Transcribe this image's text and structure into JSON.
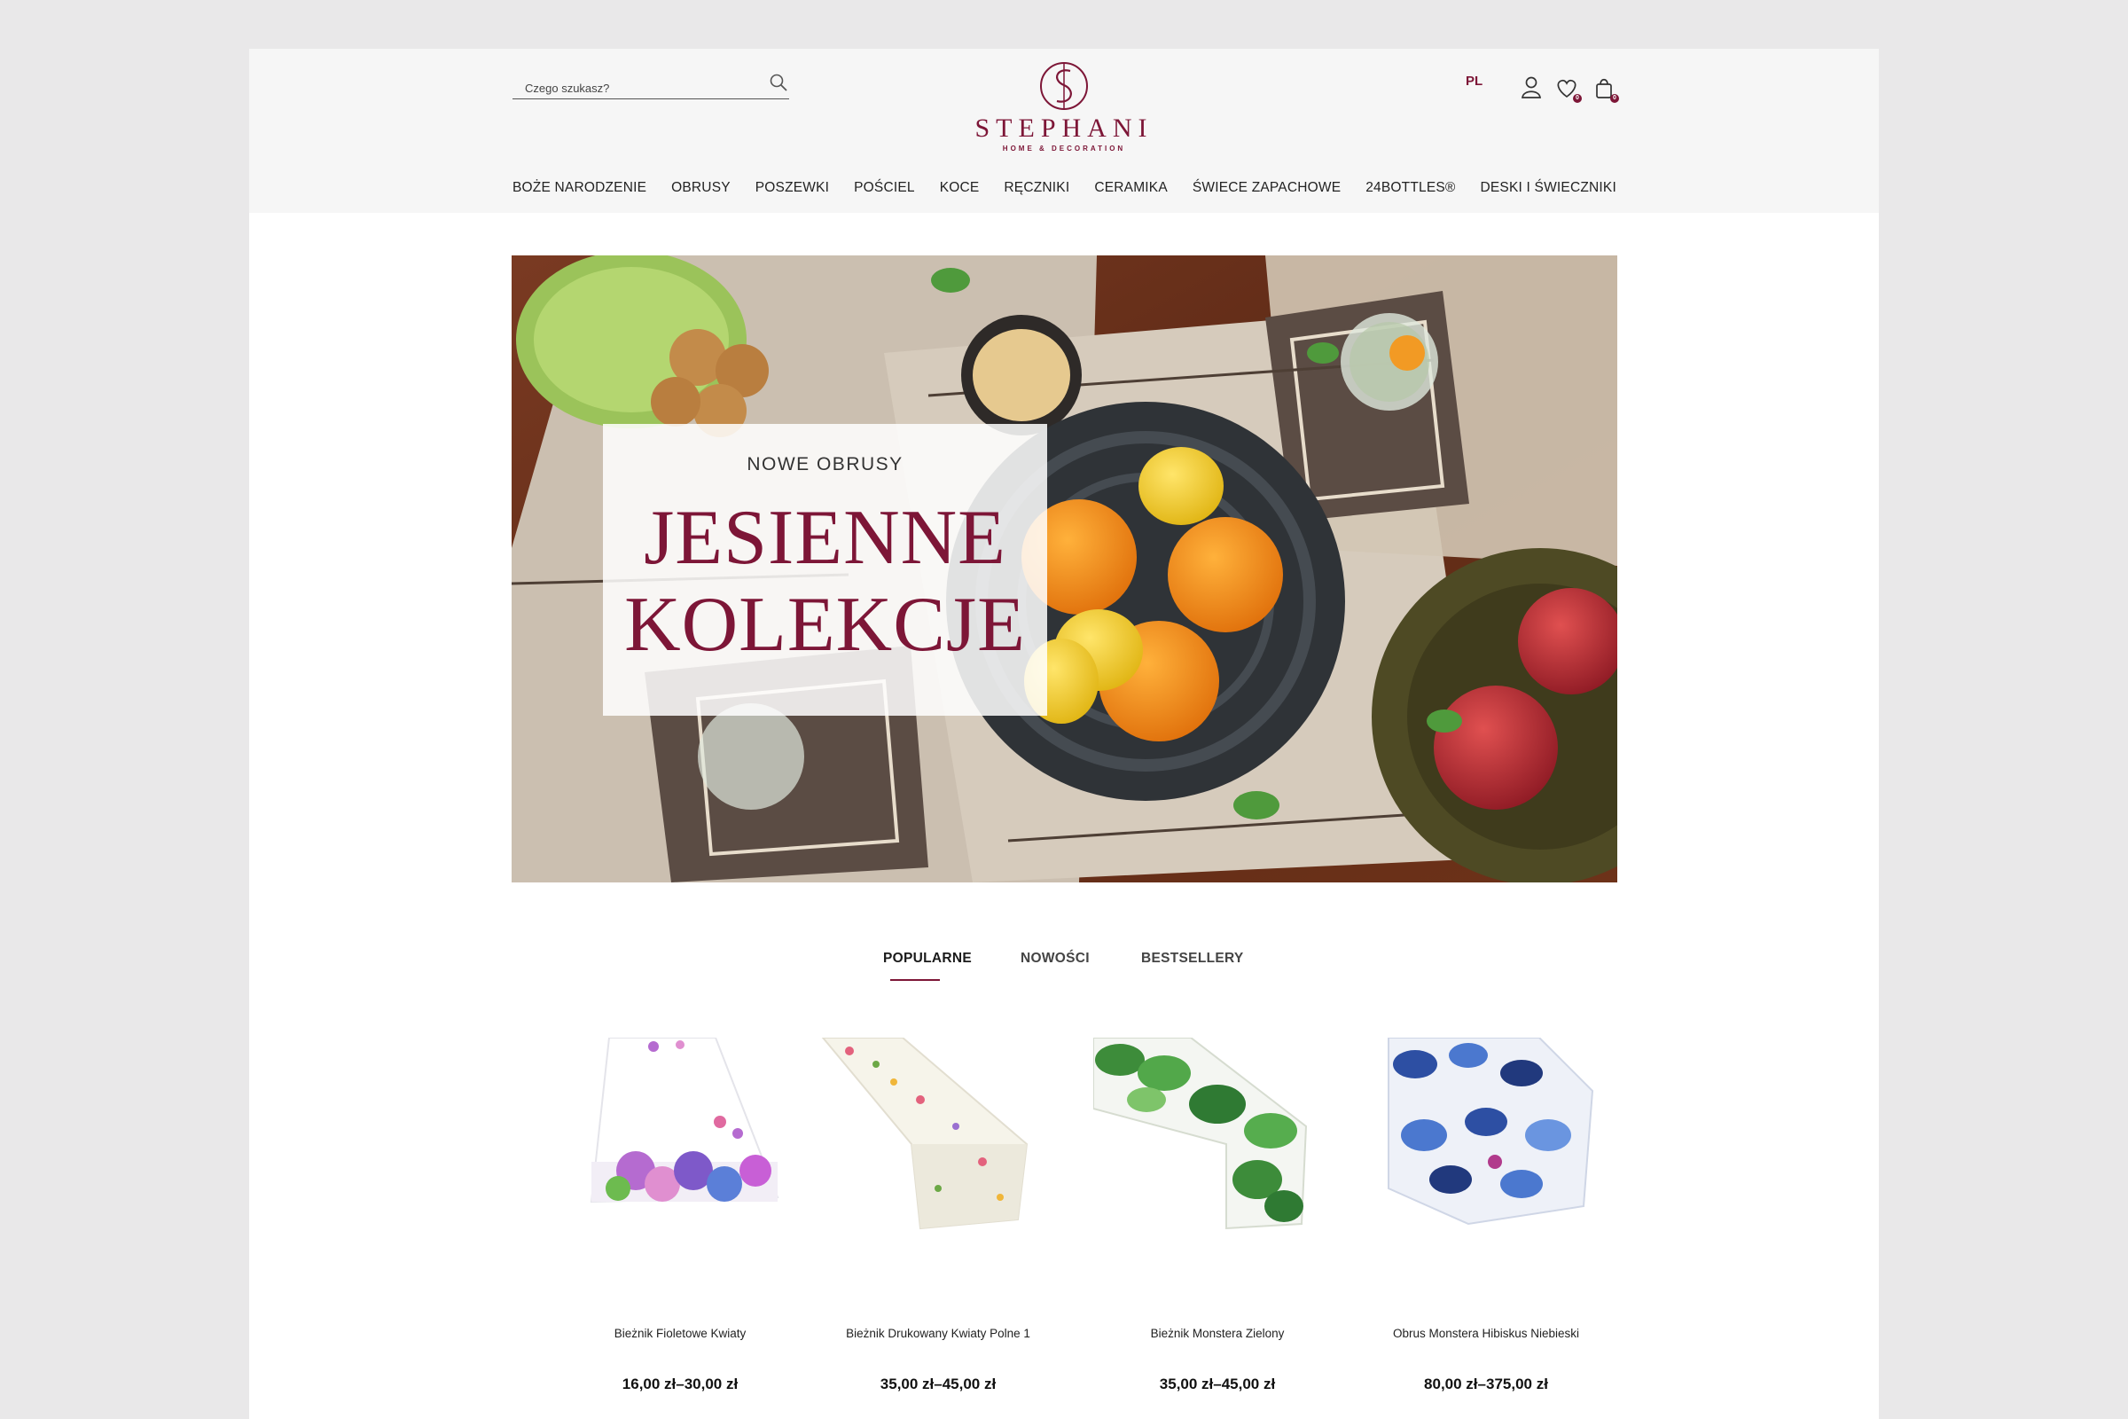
{
  "header": {
    "search_placeholder": "Czego szukasz?",
    "logo_name": "STEPHANI",
    "logo_tagline": "HOME & DECORATION",
    "language": "PL",
    "wishlist_count": "0",
    "cart_count": "0"
  },
  "nav": {
    "items": [
      "BOŻE NARODZENIE",
      "OBRUSY",
      "POSZEWKI",
      "POŚCIEL",
      "KOCE",
      "RĘCZNIKI",
      "CERAMIKA",
      "ŚWIECE ZAPACHOWE",
      "24BOTTLES®",
      "DESKI I ŚWIECZNIKI"
    ]
  },
  "hero": {
    "subtitle": "NOWE OBRUSY",
    "title_line1": "JESIENNE",
    "title_line2": "KOLEKCJE"
  },
  "tabs": {
    "items": [
      "POPULARNE",
      "NOWOŚCI",
      "BESTSELLERY"
    ],
    "active": "POPULARNE"
  },
  "products": [
    {
      "name": "Bieżnik Fioletowe Kwiaty",
      "price": "16,00 zł–30,00 zł"
    },
    {
      "name": "Bieżnik Drukowany Kwiaty Polne 1",
      "price": "35,00 zł–45,00 zł"
    },
    {
      "name": "Bieżnik Monstera Zielony",
      "price": "35,00 zł–45,00 zł"
    },
    {
      "name": "Obrus Monstera Hibiskus Niebieski",
      "price": "80,00 zł–375,00 zł"
    }
  ],
  "colors": {
    "brand": "#7d1637",
    "header_bg": "#f6f6f6",
    "outer_bg": "#e9e8e9"
  },
  "icons": [
    "search-icon",
    "user-icon",
    "heart-icon",
    "bag-icon",
    "logo-monogram-icon"
  ]
}
